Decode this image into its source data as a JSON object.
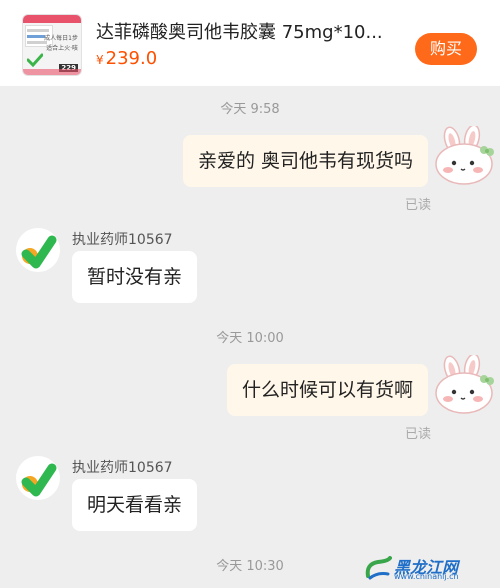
{
  "product": {
    "title": "达菲磷酸奥司他韦胶囊 75mg*10...",
    "price_symbol": "¥",
    "price": "239.0",
    "buy_label": "购买",
    "thumb_line1": "成人每日1步",
    "thumb_line2": "适合上火·咳",
    "thumb_price": "229"
  },
  "messages": [
    {
      "type": "timestamp",
      "text": "今天 9:58"
    },
    {
      "type": "outgoing",
      "text": "亲爱的  奥司他韦有现货吗",
      "status": "已读"
    },
    {
      "type": "incoming",
      "sender": "执业药师10567",
      "text": "暂时没有亲"
    },
    {
      "type": "timestamp",
      "text": "今天 10:00"
    },
    {
      "type": "outgoing",
      "text": "什么时候可以有货啊",
      "status": "已读"
    },
    {
      "type": "incoming",
      "sender": "执业药师10567",
      "text": "明天看看亲"
    },
    {
      "type": "timestamp",
      "text": "今天 10:30"
    }
  ],
  "watermark": {
    "title": "黑龙江网",
    "url": "www.chinahlj.cn"
  },
  "colors": {
    "price": "#ff5000",
    "buy_button": "#ff6a1a",
    "outgoing_bubble": "#fff7e9",
    "incoming_bubble": "#ffffff",
    "background": "#eeeeee"
  },
  "icons": {
    "pharmacist_avatar": "yellow-green-check-logo-icon",
    "user_avatar": "bunny-sticker-icon"
  }
}
